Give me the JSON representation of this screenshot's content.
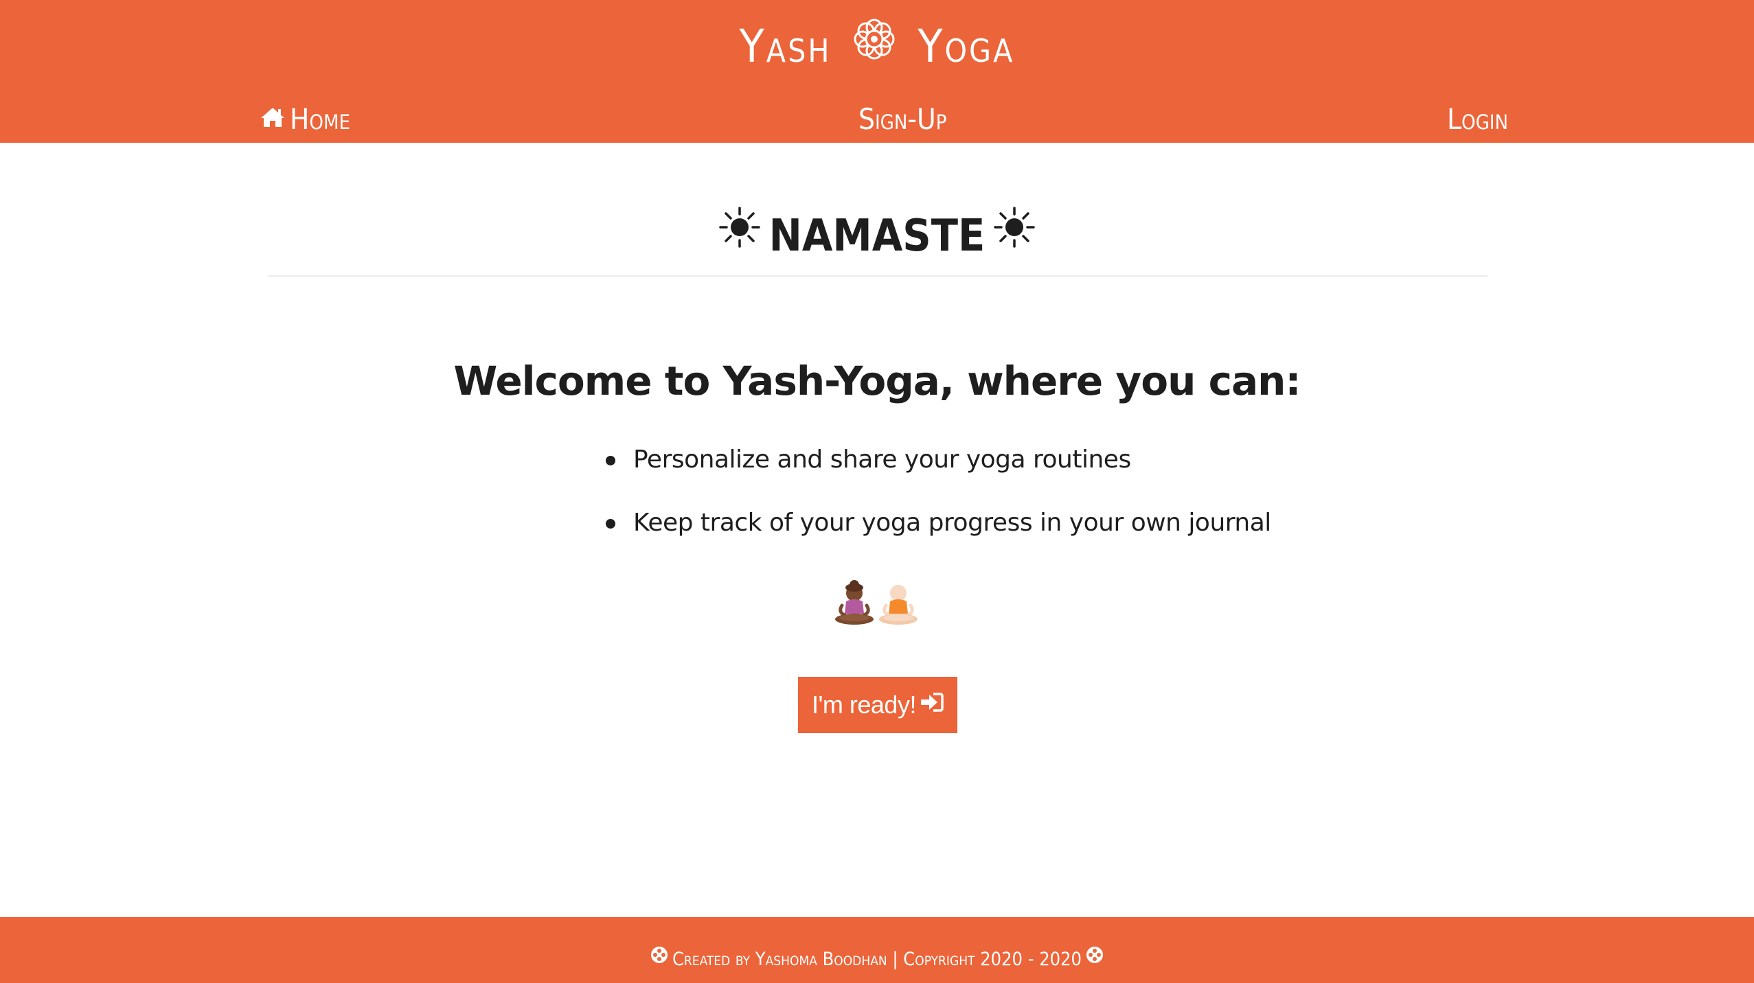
{
  "colors": {
    "accent": "#ec6439",
    "text": "#1e1e1e",
    "background": "#ffffff"
  },
  "header": {
    "brand_left": "Yash",
    "brand_icon": "flower-icon",
    "brand_right": "Yoga",
    "nav": {
      "home_icon": "home-icon",
      "home_label": "Home",
      "signup_label": "Sign-Up",
      "login_label": "Login"
    }
  },
  "main": {
    "greeting_icon": "sun-icon",
    "greeting": "NAMASTE",
    "welcome": "Welcome to Yash-Yoga, where you can:",
    "features": [
      "Personalize and share your yoga routines",
      "Keep track of your yoga progress in your own journal"
    ],
    "illustration": "meditating-people-icon",
    "ready_button": {
      "label": "I'm ready!",
      "icon": "sign-in-icon"
    }
  },
  "footer": {
    "text": "Created by Yashoma Boodhan | Copyright 2020 - 2020",
    "icon": "flower-icon"
  }
}
